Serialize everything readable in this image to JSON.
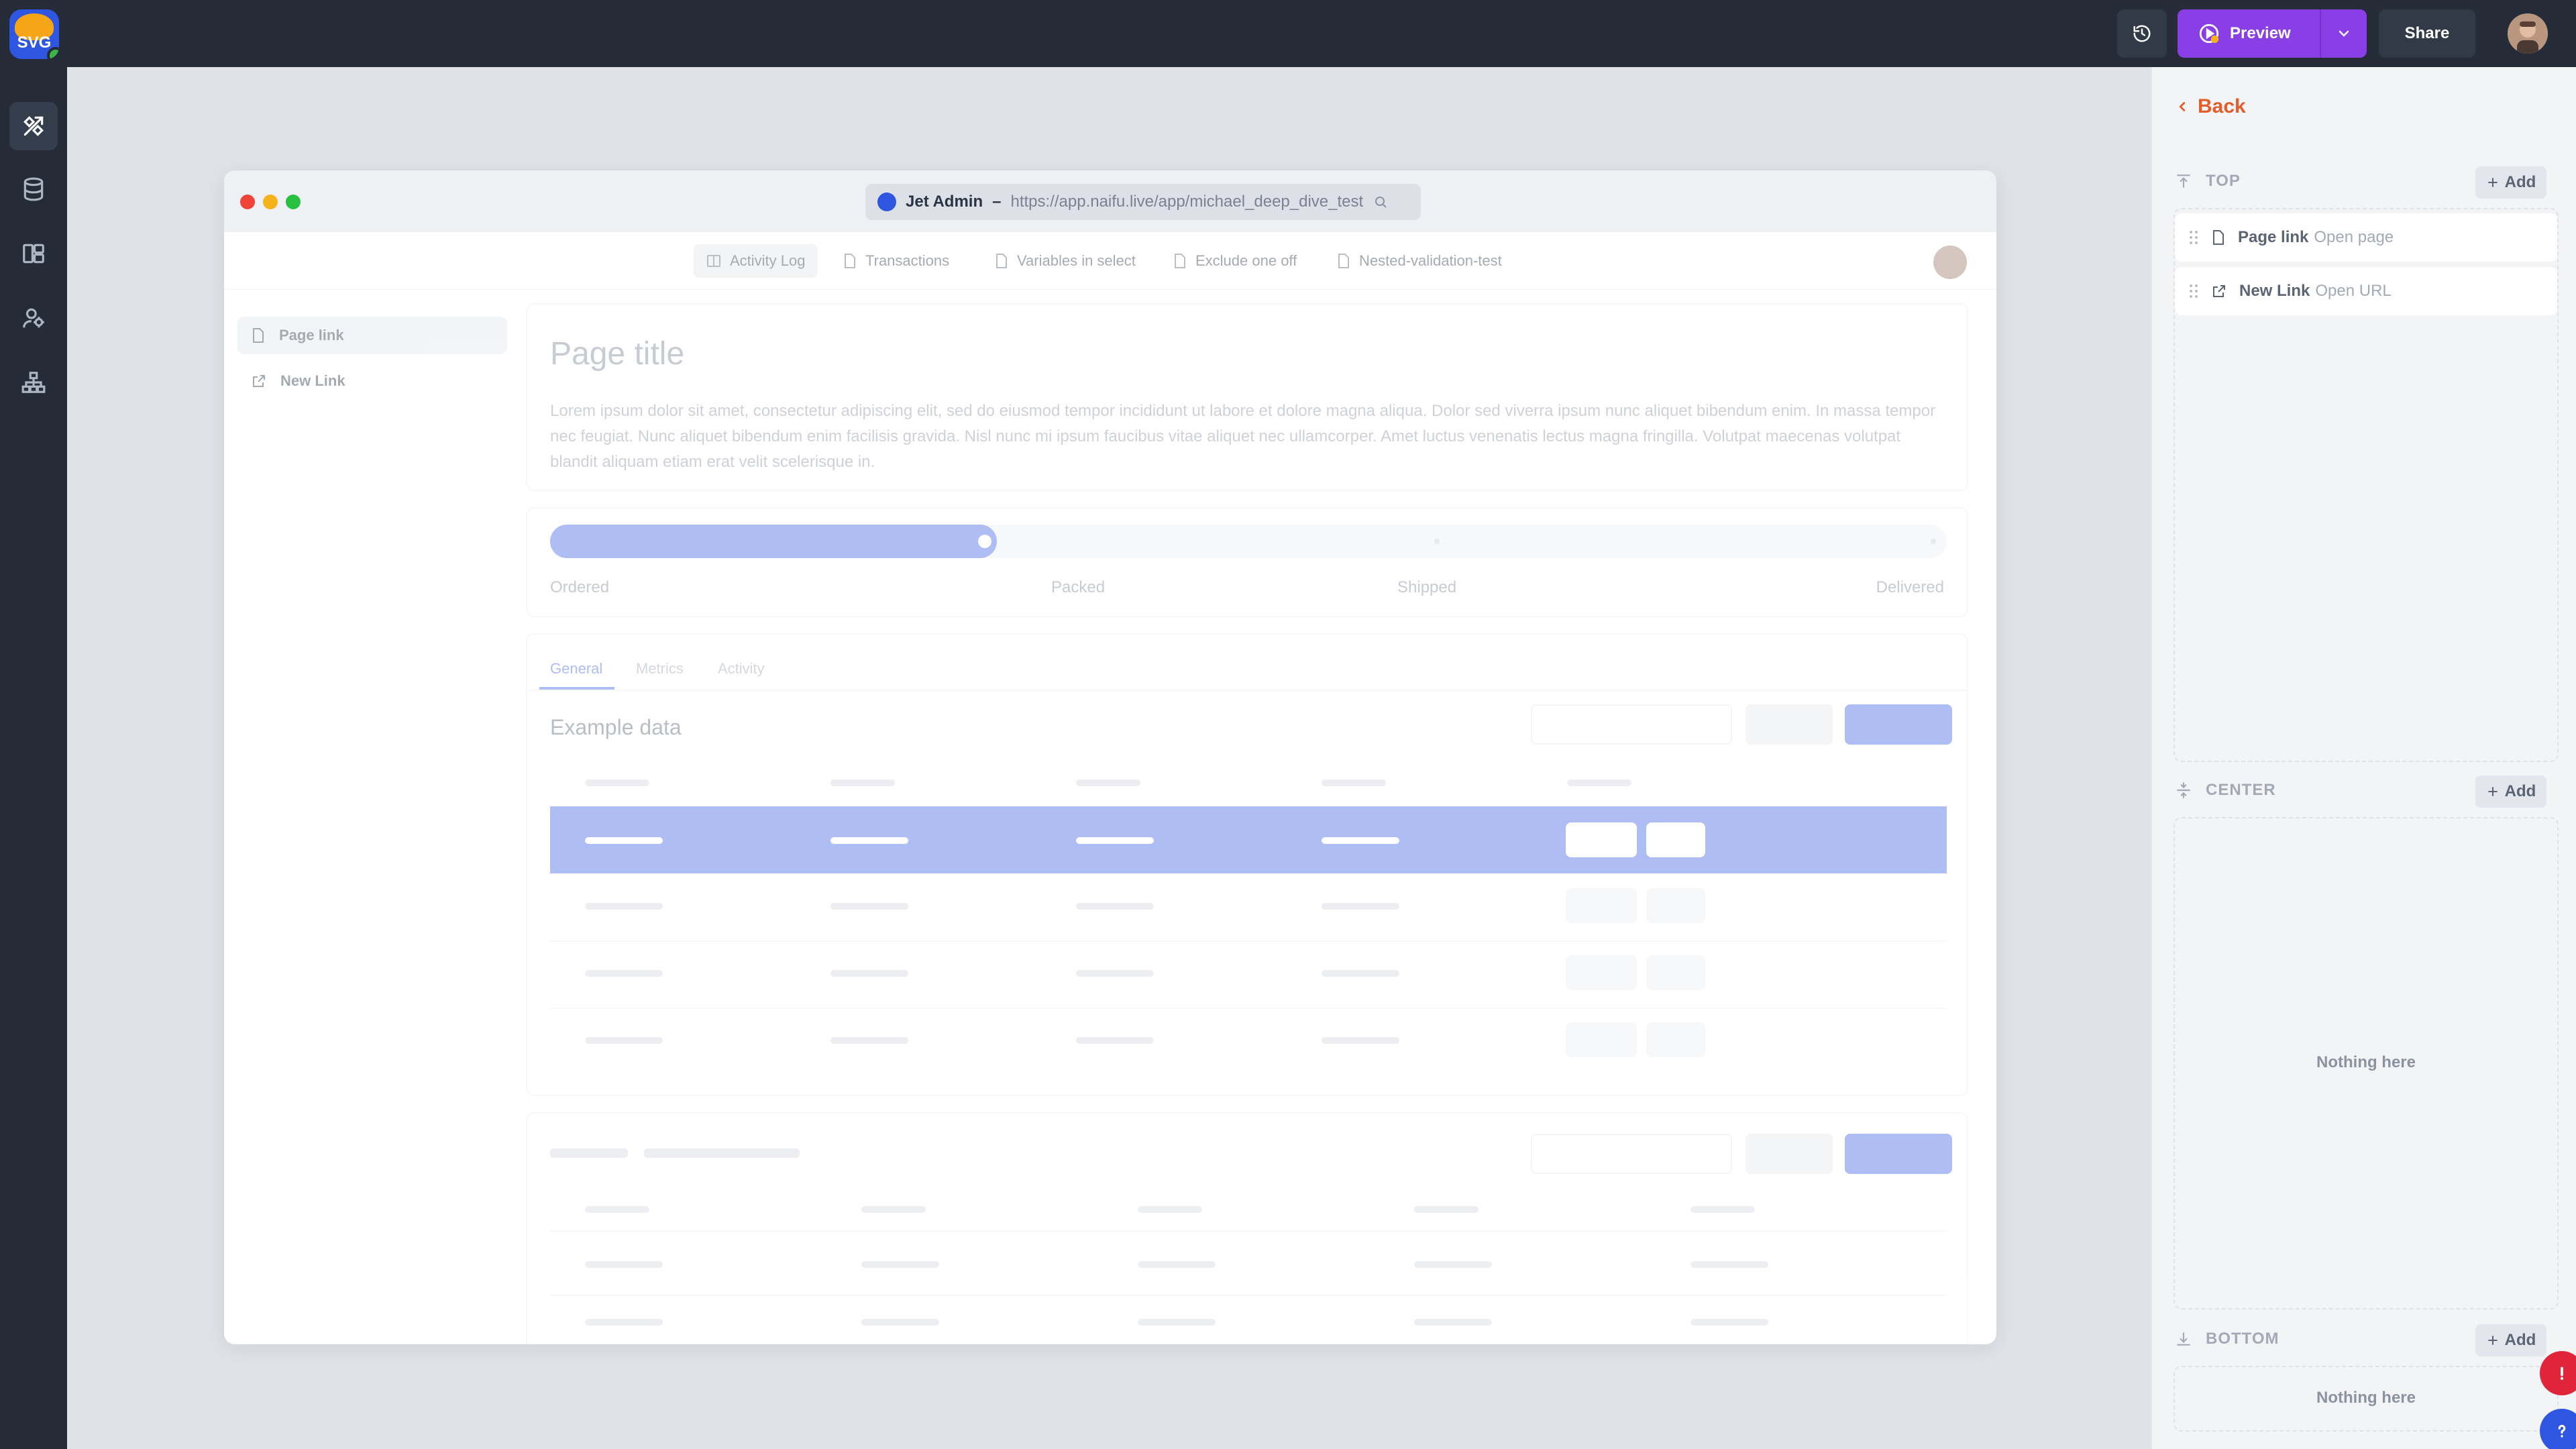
{
  "topbar": {
    "logo_text": "SVG",
    "history_label": "History",
    "preview_label": "Preview",
    "share_label": "Share"
  },
  "leftbar": {
    "items": [
      {
        "icon": "design-tools-icon",
        "active": true
      },
      {
        "icon": "database-icon",
        "active": false
      },
      {
        "icon": "layout-icon",
        "active": false
      },
      {
        "icon": "users-icon",
        "active": false
      },
      {
        "icon": "hierarchy-icon",
        "active": false
      }
    ]
  },
  "window": {
    "app_name": "Jet Admin",
    "separator": "–",
    "url": "https://app.naifu.live/app/michael_deep_dive_test",
    "nav": [
      {
        "label": "Activity Log",
        "icon": "book-icon",
        "active": true
      },
      {
        "label": "Transactions",
        "icon": "page-icon"
      },
      {
        "label": "Variables in select",
        "icon": "page-icon"
      },
      {
        "label": "Exclude one off",
        "icon": "page-icon"
      },
      {
        "label": "Nested-validation-test",
        "icon": "page-icon"
      }
    ],
    "sidebar": [
      {
        "label": "Page link",
        "icon": "page-icon",
        "active": true
      },
      {
        "label": "New Link",
        "icon": "external-link-icon"
      }
    ],
    "page_title": "Page title",
    "lorem": "Lorem ipsum dolor sit amet, consectetur adipiscing elit, sed do eiusmod tempor incididunt ut labore et dolore magna aliqua. Dolor sed viverra ipsum nunc aliquet bibendum enim. In massa tempor nec feugiat. Nunc aliquet bibendum enim facilisis gravida. Nisl nunc mi ipsum faucibus vitae aliquet nec ullamcorper. Amet luctus venenatis lectus magna fringilla. Volutpat maecenas volutpat blandit aliquam etiam erat velit scelerisque in.",
    "progress": {
      "steps": [
        "Ordered",
        "Packed",
        "Shipped",
        "Delivered"
      ],
      "completed_fraction": 0.32
    },
    "tabs": [
      "General",
      "Metrics",
      "Activity"
    ],
    "section_title": "Example data"
  },
  "panel": {
    "back_label": "Back",
    "sections": {
      "top": {
        "label": "TOP",
        "add": "Add"
      },
      "center": {
        "label": "CENTER",
        "add": "Add",
        "empty": "Nothing here"
      },
      "bottom": {
        "label": "BOTTOM",
        "add": "Add",
        "empty": "Nothing here"
      }
    },
    "items": [
      {
        "name": "Page link",
        "sub": "Open page",
        "icon": "page-icon"
      },
      {
        "name": "New Link",
        "sub": "Open URL",
        "icon": "external-link-icon"
      }
    ]
  },
  "colors": {
    "accent": "#3f63e6",
    "preview": "#8a3fe6",
    "back": "#e25c2c",
    "error": "#e0243a",
    "help": "#2f56e0"
  }
}
